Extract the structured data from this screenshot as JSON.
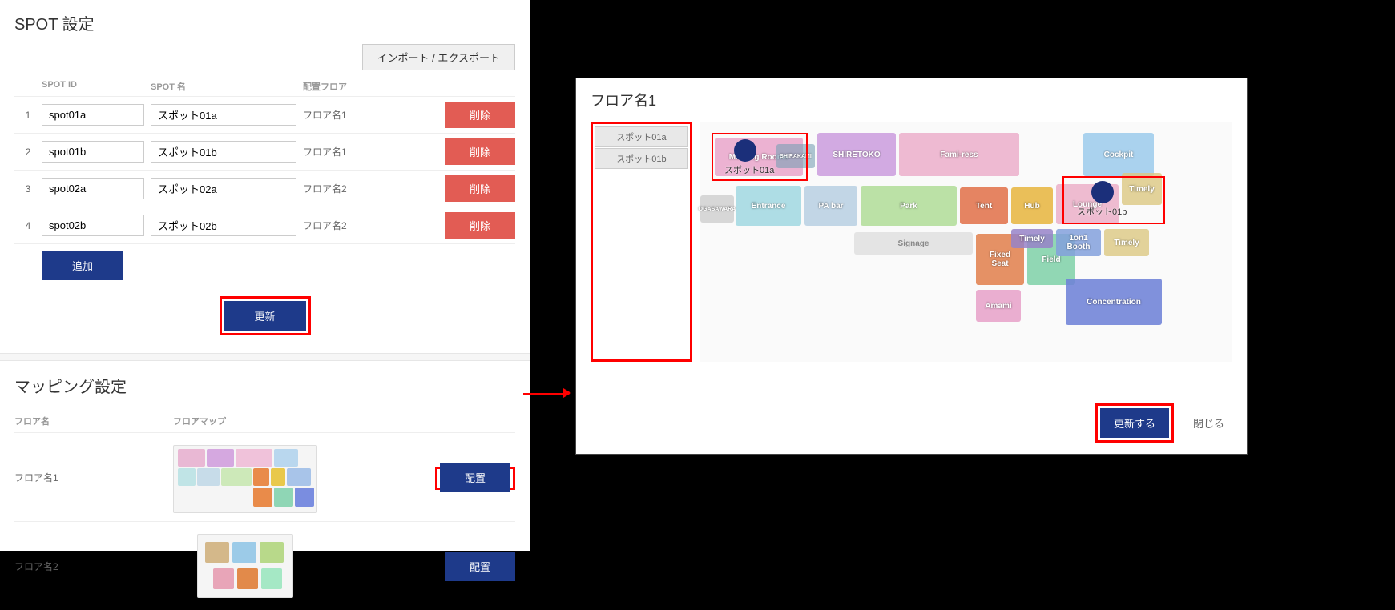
{
  "left": {
    "spot_settings_title": "SPOT 設定",
    "import_export": "インポート / エクスポート",
    "headers": {
      "id": "SPOT ID",
      "name": "SPOT 名",
      "floor": "配置フロア"
    },
    "rows": [
      {
        "n": "1",
        "id": "spot01a",
        "name": "スポット01a",
        "floor": "フロア名1"
      },
      {
        "n": "2",
        "id": "spot01b",
        "name": "スポット01b",
        "floor": "フロア名1"
      },
      {
        "n": "3",
        "id": "spot02a",
        "name": "スポット02a",
        "floor": "フロア名2"
      },
      {
        "n": "4",
        "id": "spot02b",
        "name": "スポット02b",
        "floor": "フロア名2"
      }
    ],
    "delete": "削除",
    "add": "追加",
    "update": "更新",
    "mapping_title": "マッピング設定",
    "mapping_headers": {
      "name": "フロア名",
      "map": "フロアマップ"
    },
    "mapping_rows": [
      {
        "name": "フロア名1"
      },
      {
        "name": "フロア名2"
      }
    ],
    "place": "配置"
  },
  "right": {
    "title": "フロア名1",
    "list": [
      "スポット01a",
      "スポット01b"
    ],
    "rooms": {
      "meeting": "Meeting Rooms",
      "shiretoko": "SHIRETOKO",
      "famiress": "Fami-ress",
      "cockpit": "Cockpit",
      "entrance": "Entrance",
      "pabar": "PA bar",
      "park": "Park",
      "tent": "Tent",
      "hub": "Hub",
      "lounge": "Lounge",
      "timely": "Timely",
      "signage": "Signage",
      "fixedseat": "Fixed\nSeat",
      "field": "Field",
      "onon": "1on1\nBooth",
      "timely2": "Timely",
      "amami": "Amami",
      "concentration": "Concentration",
      "shirakami": "SHIRAKAMI",
      "ogasawara": "OGASAWARA"
    },
    "spot01a_label": "スポット01a",
    "spot01b_label": "スポット01b",
    "update": "更新する",
    "close": "閉じる"
  }
}
